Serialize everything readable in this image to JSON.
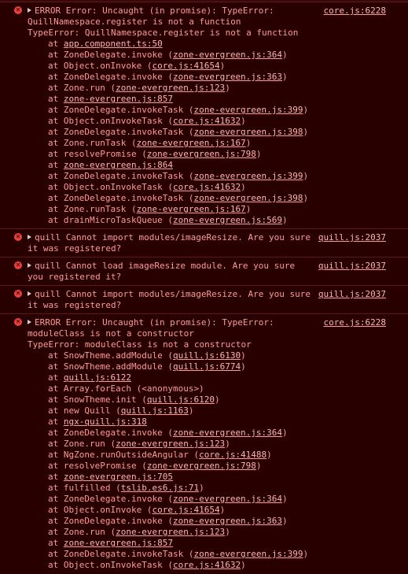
{
  "colors": {
    "background": "#280000",
    "text": "#ff9a9a",
    "link": "#ffb3b3",
    "icon": "#e8403a",
    "separator": "#5c1c1c"
  },
  "messages": [
    {
      "icon": "error-circle-icon",
      "source": "core.js:6228",
      "lines": [
        "ERROR Error: Uncaught (in promise): TypeError:",
        "QuillNamespace.register is not a function",
        "TypeError: QuillNamespace.register is not a function"
      ],
      "frames": [
        {
          "fn": "",
          "loc": "app.component.ts:50"
        },
        {
          "fn": "ZoneDelegate.invoke",
          "loc": "zone-evergreen.js:364"
        },
        {
          "fn": "Object.onInvoke",
          "loc": "core.js:41654"
        },
        {
          "fn": "ZoneDelegate.invoke",
          "loc": "zone-evergreen.js:363"
        },
        {
          "fn": "Zone.run",
          "loc": "zone-evergreen.js:123"
        },
        {
          "fn": "",
          "loc": "zone-evergreen.js:857"
        },
        {
          "fn": "ZoneDelegate.invokeTask",
          "loc": "zone-evergreen.js:399"
        },
        {
          "fn": "Object.onInvokeTask",
          "loc": "core.js:41632"
        },
        {
          "fn": "ZoneDelegate.invokeTask",
          "loc": "zone-evergreen.js:398"
        },
        {
          "fn": "Zone.runTask",
          "loc": "zone-evergreen.js:167"
        },
        {
          "fn": "resolvePromise",
          "loc": "zone-evergreen.js:798"
        },
        {
          "fn": "",
          "loc": "zone-evergreen.js:864"
        },
        {
          "fn": "ZoneDelegate.invokeTask",
          "loc": "zone-evergreen.js:399"
        },
        {
          "fn": "Object.onInvokeTask",
          "loc": "core.js:41632"
        },
        {
          "fn": "ZoneDelegate.invokeTask",
          "loc": "zone-evergreen.js:398"
        },
        {
          "fn": "Zone.runTask",
          "loc": "zone-evergreen.js:167"
        },
        {
          "fn": "drainMicroTaskQueue",
          "loc": "zone-evergreen.js:569"
        }
      ]
    },
    {
      "icon": "error-circle-icon",
      "source": "quill.js:2037",
      "lines": [
        "quill Cannot import modules/imageResize. Are you sure",
        "it was registered?"
      ],
      "frames": []
    },
    {
      "icon": "error-circle-icon",
      "source": "quill.js:2037",
      "lines": [
        "quill Cannot load imageResize module. Are you sure",
        "you registered it?"
      ],
      "frames": []
    },
    {
      "icon": "error-circle-icon",
      "source": "quill.js:2037",
      "lines": [
        "quill Cannot import modules/imageResize. Are you sure",
        "it was registered?"
      ],
      "frames": []
    },
    {
      "icon": "error-circle-icon",
      "source": "core.js:6228",
      "lines": [
        "ERROR Error: Uncaught (in promise): TypeError:",
        "moduleClass is not a constructor",
        "TypeError: moduleClass is not a constructor"
      ],
      "frames": [
        {
          "fn": "SnowTheme.addModule",
          "loc": "quill.js:6130"
        },
        {
          "fn": "SnowTheme.addModule",
          "loc": "quill.js:6774"
        },
        {
          "fn": "",
          "loc": "quill.js:6122"
        },
        {
          "fn": "Array.forEach (<anonymous>)",
          "loc": ""
        },
        {
          "fn": "SnowTheme.init",
          "loc": "quill.js:6120"
        },
        {
          "fn": "new Quill",
          "loc": "quill.js:1163"
        },
        {
          "fn": "",
          "loc": "ngx-quill.js:318"
        },
        {
          "fn": "ZoneDelegate.invoke",
          "loc": "zone-evergreen.js:364"
        },
        {
          "fn": "Zone.run",
          "loc": "zone-evergreen.js:123"
        },
        {
          "fn": "NgZone.runOutsideAngular",
          "loc": "core.js:41488"
        },
        {
          "fn": "resolvePromise",
          "loc": "zone-evergreen.js:798"
        },
        {
          "fn": "",
          "loc": "zone-evergreen.js:705"
        },
        {
          "fn": "fulfilled",
          "loc": "tslib.es6.js:71"
        },
        {
          "fn": "ZoneDelegate.invoke",
          "loc": "zone-evergreen.js:364"
        },
        {
          "fn": "Object.onInvoke",
          "loc": "core.js:41654"
        },
        {
          "fn": "ZoneDelegate.invoke",
          "loc": "zone-evergreen.js:363"
        },
        {
          "fn": "Zone.run",
          "loc": "zone-evergreen.js:123"
        },
        {
          "fn": "",
          "loc": "zone-evergreen.js:857"
        },
        {
          "fn": "ZoneDelegate.invokeTask",
          "loc": "zone-evergreen.js:399"
        },
        {
          "fn": "Object.onInvokeTask",
          "loc": "core.js:41632"
        }
      ]
    }
  ]
}
